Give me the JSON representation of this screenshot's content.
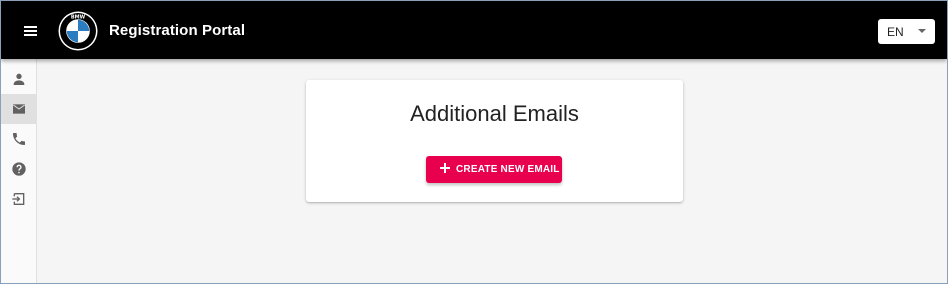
{
  "header": {
    "menu_icon": "hamburger-icon",
    "logo": "bmw-logo",
    "logo_text": "BMW",
    "title": "Registration Portal",
    "language": {
      "value": "EN",
      "icon": "caret-down-icon"
    }
  },
  "sidebar": {
    "items": [
      {
        "icon": "person-icon",
        "active": false
      },
      {
        "icon": "email-icon",
        "active": true
      },
      {
        "icon": "phone-icon",
        "active": false
      },
      {
        "icon": "help-icon",
        "active": false
      },
      {
        "icon": "logout-icon",
        "active": false
      }
    ]
  },
  "main": {
    "card_title": "Additional Emails",
    "create_button": {
      "label": "CREATE NEW EMAIL",
      "icon": "plus-icon"
    }
  },
  "colors": {
    "topbar": "#000000",
    "accent": "#e8004f",
    "background": "#f5f5f5",
    "active_nav": "#e0e0e0",
    "bmw_blue": "#2b7cc1"
  }
}
